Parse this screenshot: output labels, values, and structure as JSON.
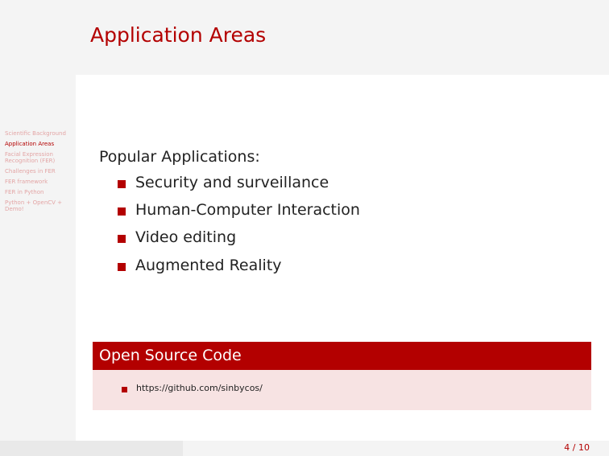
{
  "sidebar": {
    "items": [
      {
        "label": "Scientific Background"
      },
      {
        "label": "Application Areas"
      },
      {
        "label": "Facial Expression Recognition (FER)"
      },
      {
        "label": "Challenges in FER"
      },
      {
        "label": "FER framework"
      },
      {
        "label": "FER in Python"
      },
      {
        "label": "Python + OpenCV + Demo!"
      }
    ],
    "active_index": 1
  },
  "slide": {
    "title": "Application Areas",
    "intro": "Popular Applications:",
    "items": [
      "Security and surveillance",
      "Human-Computer Interaction",
      "Video editing",
      "Augmented Reality"
    ]
  },
  "block": {
    "title": "Open Source Code",
    "link": "https://github.com/sinbycos/"
  },
  "footer": {
    "page": "4 / 10"
  },
  "colors": {
    "accent": "#b30000",
    "block_body": "#f7e3e3",
    "sidebar_bg": "#f4f4f4",
    "inactive_nav": "#e3a5a5"
  }
}
